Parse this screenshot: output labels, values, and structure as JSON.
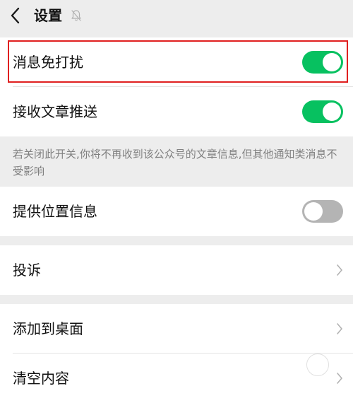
{
  "header": {
    "title": "设置",
    "back_icon": "back-chevron-icon",
    "mute_icon": "bell-muted-icon"
  },
  "settings": {
    "mute_notifications": {
      "label": "消息免打扰",
      "enabled": true
    },
    "receive_articles": {
      "label": "接收文章推送",
      "enabled": true
    },
    "note": "若关闭此开关,你将不再收到该公众号的文章信息,但其他通知类消息不受影响",
    "share_location": {
      "label": "提供位置信息",
      "enabled": false
    },
    "complaint": {
      "label": "投诉"
    },
    "add_to_desktop": {
      "label": "添加到桌面"
    },
    "clear_content": {
      "label": "清空内容"
    }
  },
  "colors": {
    "toggle_on": "#07c160",
    "toggle_off": "#b4b4b4",
    "highlight": "#e02020",
    "background": "#ededed"
  }
}
